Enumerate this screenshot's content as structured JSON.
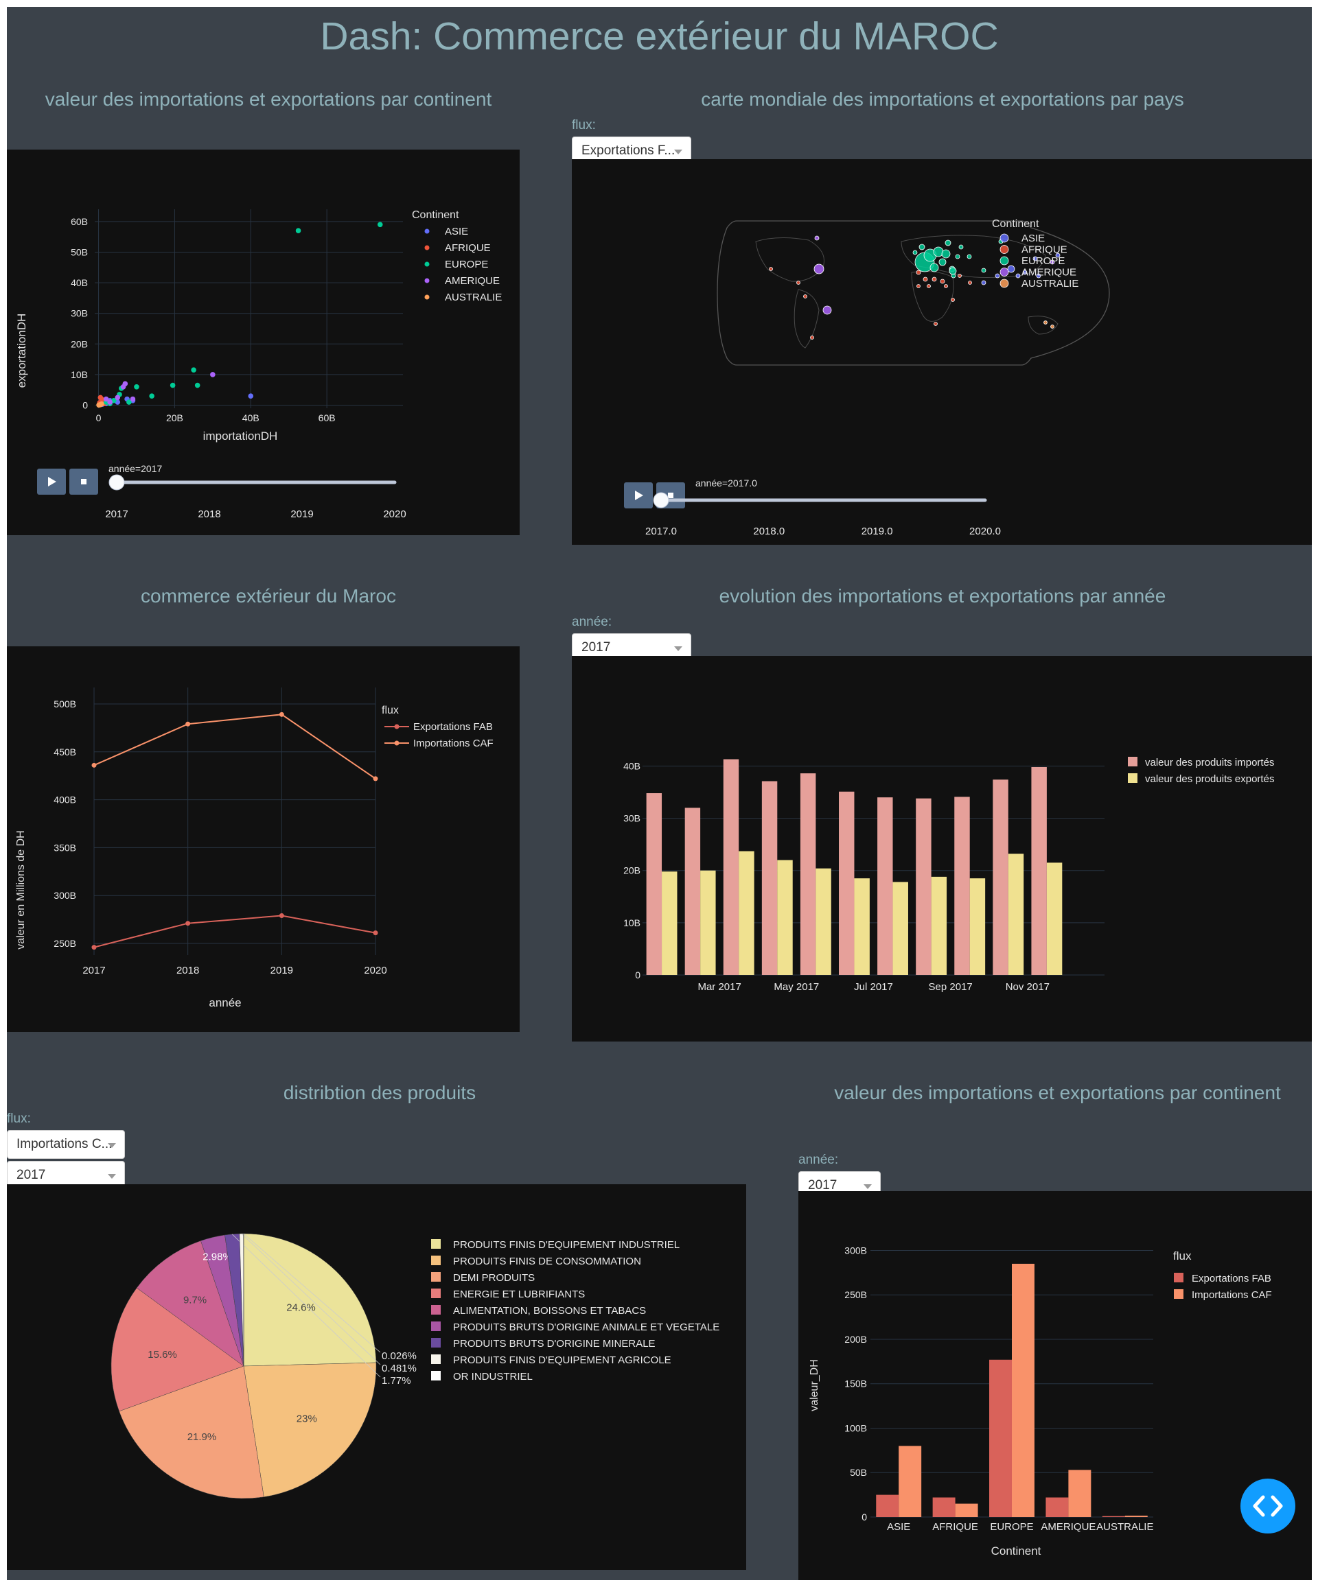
{
  "page_title": "Dash: Commerce extérieur du MAROC",
  "sections": {
    "scatter_title": "valeur des importations et exportations par continent",
    "map_title": "carte mondiale des importations et exportations par pays",
    "line_title": "commerce extérieur du Maroc",
    "bar_title": "evolution des importations et exportations par année",
    "pie_title": "distribtion des produits",
    "stack_title": "valeur des importations et exportations par continent"
  },
  "controls": {
    "map_flux_label": "flux:",
    "map_flux_value": "Exportations F...",
    "bar_year_label": "année:",
    "bar_year_value": "2017",
    "pie_flux_label": "flux:",
    "pie_flux_value": "Importations C...",
    "pie_year_value": "2017",
    "stack_year_label": "année:",
    "stack_year_value": "2017"
  },
  "colors": {
    "background": "#3b424a",
    "panel": "#111111",
    "title_text": "#8fb2ba",
    "fab": "#119dff"
  },
  "chart_data": [
    {
      "id": "scatter",
      "type": "scatter",
      "xlabel": "importationDH",
      "ylabel": "exportationDH",
      "xticks": [
        "0",
        "20B",
        "40B",
        "60B"
      ],
      "yticks": [
        "0",
        "10B",
        "20B",
        "30B",
        "40B",
        "50B",
        "60B"
      ],
      "xlim": [
        -1,
        80
      ],
      "ylim": [
        -1,
        64
      ],
      "legend_title": "Continent",
      "legend_position": "right",
      "series": [
        {
          "name": "ASIE",
          "color": "#636efa",
          "points": [
            [
              40,
              3
            ],
            [
              7.5,
              2
            ],
            [
              9,
              1.5
            ],
            [
              5,
              1
            ],
            [
              2,
              0.5
            ],
            [
              1,
              0.3
            ],
            [
              3,
              1.5
            ],
            [
              0.5,
              0.2
            ]
          ]
        },
        {
          "name": "AFRIQUE",
          "color": "#ef553b",
          "points": [
            [
              0.5,
              2.5
            ],
            [
              1,
              1.5
            ],
            [
              0.3,
              0.8
            ],
            [
              1.5,
              0.5
            ],
            [
              0.2,
              0.3
            ],
            [
              2.5,
              1
            ],
            [
              0.8,
              2
            ]
          ]
        },
        {
          "name": "EUROPE",
          "color": "#00cc96",
          "points": [
            [
              74,
              59
            ],
            [
              52.5,
              57
            ],
            [
              25,
              11.5
            ],
            [
              26,
              6.5
            ],
            [
              19.5,
              6.5
            ],
            [
              14,
              3
            ],
            [
              10,
              6
            ],
            [
              6,
              5.5
            ],
            [
              5.5,
              3.5
            ],
            [
              8,
              1
            ],
            [
              4,
              1.5
            ],
            [
              3,
              0.5
            ],
            [
              2,
              1
            ]
          ]
        },
        {
          "name": "AMERIQUE",
          "color": "#ab63fa",
          "points": [
            [
              30,
              10
            ],
            [
              7,
              7
            ],
            [
              6.5,
              6
            ],
            [
              9,
              2
            ],
            [
              3,
              1
            ],
            [
              5,
              2.5
            ],
            [
              2,
              2
            ]
          ]
        },
        {
          "name": "AUSTRALIE",
          "color": "#ffa15a",
          "points": [
            [
              0.3,
              0.1
            ],
            [
              0.5,
              0.2
            ],
            [
              0.1,
              0.05
            ],
            [
              0.8,
              0.4
            ]
          ]
        }
      ],
      "slider": {
        "label": "année=2017",
        "ticks": [
          "2017",
          "2018",
          "2019",
          "2020"
        ],
        "value_fraction": 0
      }
    },
    {
      "id": "map",
      "type": "scatter",
      "legend_title": "Continent",
      "legend_position": "right",
      "legend": [
        {
          "name": "ASIE",
          "color": "#636efa"
        },
        {
          "name": "AFRIQUE",
          "color": "#ef553b"
        },
        {
          "name": "EUROPE",
          "color": "#00cc96"
        },
        {
          "name": "AMERIQUE",
          "color": "#ab63fa"
        },
        {
          "name": "AUSTRALIE",
          "color": "#ffa15a"
        }
      ],
      "slider": {
        "label": "année=2017.0",
        "ticks": [
          "2017.0",
          "2018.0",
          "2019.0",
          "2020.0"
        ],
        "value_fraction": 0
      }
    },
    {
      "id": "line",
      "type": "line",
      "xlabel": "année",
      "ylabel": "valeur en Millions de DH",
      "x": [
        2017,
        2018,
        2019,
        2020
      ],
      "xticks": [
        "2017",
        "2018",
        "2019",
        "2020"
      ],
      "yticks": [
        "250B",
        "300B",
        "350B",
        "400B",
        "450B",
        "500B"
      ],
      "ylim": [
        245,
        510
      ],
      "legend_title": "flux",
      "legend_position": "right",
      "series": [
        {
          "name": "Exportations FAB",
          "color": "#d9625a",
          "values": [
            246,
            271,
            279,
            261
          ]
        },
        {
          "name": "Importations CAF",
          "color": "#f9926a",
          "values": [
            436,
            479,
            489,
            422
          ]
        }
      ]
    },
    {
      "id": "monthly_bar",
      "type": "bar",
      "categories": [
        "Jan 2017",
        "Feb 2017",
        "Mar 2017",
        "Apr 2017",
        "May 2017",
        "Jun 2017",
        "Jul 2017",
        "Aug 2017",
        "Sep 2017",
        "Oct 2017",
        "Nov 2017",
        "Dec 2017"
      ],
      "xticks": [
        "Mar 2017",
        "May 2017",
        "Jul 2017",
        "Sep 2017",
        "Nov 2017"
      ],
      "yticks": [
        "0",
        "10B",
        "20B",
        "30B",
        "40B"
      ],
      "ylim": [
        0,
        44
      ],
      "legend_position": "right",
      "series": [
        {
          "name": "valeur des produits importés",
          "color": "#e6a09a",
          "values": [
            34.8,
            32,
            41.3,
            37.1,
            38.6,
            35.1,
            34,
            33.8,
            34.1,
            37.4,
            39.8,
            0
          ]
        },
        {
          "name": "valeur des produits exportés",
          "color": "#f0e190",
          "values": [
            19.8,
            20,
            23.7,
            22,
            20.4,
            18.5,
            17.8,
            18.8,
            18.5,
            23.2,
            21.5,
            0
          ]
        }
      ]
    },
    {
      "id": "pie",
      "type": "pie",
      "legend_position": "right",
      "slices": [
        {
          "label": "PRODUITS FINIS D'EQUIPEMENT INDUSTRIEL",
          "value": 24.6,
          "text": "24.6%",
          "color": "#ebe39a"
        },
        {
          "label": "PRODUITS FINIS DE CONSOMMATION",
          "value": 23,
          "text": "23%",
          "color": "#f5c17e"
        },
        {
          "label": "DEMI  PRODUITS",
          "value": 21.9,
          "text": "21.9%",
          "color": "#f4a27c"
        },
        {
          "label": "ENERGIE  ET  LUBRIFIANTS",
          "value": 15.6,
          "text": "15.6%",
          "color": "#e87d7c"
        },
        {
          "label": "ALIMENTATION, BOISSONS ET TABACS",
          "value": 9.7,
          "text": "9.7%",
          "color": "#cc6291"
        },
        {
          "label": "PRODUITS BRUTS D'ORIGINE ANIMALE ET VEGETALE",
          "value": 2.98,
          "text": "2.98%",
          "color": "#a856a5"
        },
        {
          "label": "PRODUITS BRUTS D'ORIGINE MINERALE",
          "value": 1.77,
          "text": "1.77%",
          "color": "#6b4c9f"
        },
        {
          "label": "PRODUITS FINIS D'EQUIPEMENT AGRICOLE",
          "value": 0.481,
          "text": "0.481%",
          "color": "#f8f5ec"
        },
        {
          "label": "OR INDUSTRIEL",
          "value": 0.026,
          "text": "0.026%",
          "color": "#ffffff"
        }
      ]
    },
    {
      "id": "continent_bar",
      "type": "bar",
      "xlabel": "Continent",
      "ylabel": "valeur_DH",
      "categories": [
        "ASIE",
        "AFRIQUE",
        "EUROPE",
        "AMERIQUE",
        "AUSTRALIE"
      ],
      "yticks": [
        "0",
        "50B",
        "100B",
        "150B",
        "200B",
        "250B",
        "300B"
      ],
      "ylim": [
        0,
        305
      ],
      "legend_title": "flux",
      "legend_position": "right",
      "series": [
        {
          "name": "Exportations FAB",
          "color": "#d9625a",
          "values": [
            25,
            22,
            177,
            22,
            1
          ]
        },
        {
          "name": "Importations CAF",
          "color": "#f9926a",
          "values": [
            80,
            15,
            285,
            53,
            1.5
          ]
        }
      ]
    }
  ]
}
